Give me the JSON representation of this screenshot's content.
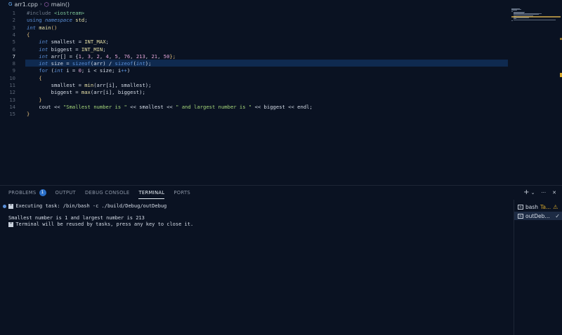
{
  "breadcrumb": {
    "file": "arr1.cpp",
    "symbol": "main()",
    "file_icon": "cpp-file-icon",
    "symbol_icon": "cube-icon"
  },
  "editor": {
    "current_line": 7,
    "line_numbers": [
      "1",
      "2",
      "3",
      "4",
      "5",
      "6",
      "7",
      "8",
      "9",
      "10",
      "11",
      "12",
      "13",
      "14",
      "15"
    ],
    "lines": [
      [
        {
          "t": "#include ",
          "c": "pp"
        },
        {
          "t": "<iostream>",
          "c": "inc"
        }
      ],
      [
        {
          "t": "using ",
          "c": "kw"
        },
        {
          "t": "namespace ",
          "c": "kwi"
        },
        {
          "t": "std",
          "c": "fn"
        },
        {
          "t": ";",
          "c": "op"
        }
      ],
      [
        {
          "t": "int ",
          "c": "kwi"
        },
        {
          "t": "main",
          "c": "fn"
        },
        {
          "t": "()",
          "c": "brk"
        }
      ],
      [
        {
          "t": "{",
          "c": "brk"
        }
      ],
      [
        {
          "t": "    int ",
          "c": "kwi"
        },
        {
          "t": "smallest = ",
          "c": "id"
        },
        {
          "t": "INT_MAX",
          "c": "fn"
        },
        {
          "t": ";",
          "c": "op"
        }
      ],
      [
        {
          "t": "    int ",
          "c": "kwi"
        },
        {
          "t": "biggest = ",
          "c": "id"
        },
        {
          "t": "INT_MIN",
          "c": "fn"
        },
        {
          "t": ";",
          "c": "op"
        }
      ],
      [
        {
          "t": "    int ",
          "c": "kwi"
        },
        {
          "t": "arr[] = {",
          "c": "id"
        },
        {
          "t": "1",
          "c": "num"
        },
        {
          "t": ", ",
          "c": "op"
        },
        {
          "t": "3",
          "c": "num"
        },
        {
          "t": ", ",
          "c": "op"
        },
        {
          "t": "2",
          "c": "num"
        },
        {
          "t": ", ",
          "c": "op"
        },
        {
          "t": "4",
          "c": "num"
        },
        {
          "t": ", ",
          "c": "op"
        },
        {
          "t": "5",
          "c": "num"
        },
        {
          "t": ", ",
          "c": "op"
        },
        {
          "t": "76",
          "c": "num"
        },
        {
          "t": ", ",
          "c": "op"
        },
        {
          "t": "213",
          "c": "num"
        },
        {
          "t": ", ",
          "c": "op"
        },
        {
          "t": "21",
          "c": "num"
        },
        {
          "t": ", ",
          "c": "op"
        },
        {
          "t": "50",
          "c": "num"
        },
        {
          "t": "};",
          "c": "brk"
        }
      ],
      [
        {
          "t": "    int ",
          "c": "kwi"
        },
        {
          "t": "size = ",
          "c": "id"
        },
        {
          "t": "sizeof",
          "c": "kw"
        },
        {
          "t": "(arr) / ",
          "c": "id"
        },
        {
          "t": "sizeof",
          "c": "kw"
        },
        {
          "t": "(",
          "c": "id"
        },
        {
          "t": "int",
          "c": "kwi"
        },
        {
          "t": ");",
          "c": "id"
        }
      ],
      [
        {
          "t": "    for ",
          "c": "kw"
        },
        {
          "t": "(",
          "c": "id"
        },
        {
          "t": "int ",
          "c": "kwi"
        },
        {
          "t": "i = ",
          "c": "id"
        },
        {
          "t": "0",
          "c": "num"
        },
        {
          "t": "; i < size; i",
          "c": "id"
        },
        {
          "t": "++",
          "c": "kw"
        },
        {
          "t": ")",
          "c": "id"
        }
      ],
      [
        {
          "t": "    {",
          "c": "brk"
        }
      ],
      [
        {
          "t": "        smallest = ",
          "c": "id"
        },
        {
          "t": "min",
          "c": "fn"
        },
        {
          "t": "(arr[i], smallest);",
          "c": "id"
        }
      ],
      [
        {
          "t": "        biggest = ",
          "c": "id"
        },
        {
          "t": "max",
          "c": "fn"
        },
        {
          "t": "(arr[i], biggest);",
          "c": "id"
        }
      ],
      [
        {
          "t": "    }",
          "c": "brk"
        }
      ],
      [
        {
          "t": "    cout << ",
          "c": "id"
        },
        {
          "t": "\"Smallest number is \"",
          "c": "str"
        },
        {
          "t": " << smallest << ",
          "c": "id"
        },
        {
          "t": "\" and largest number is \"",
          "c": "str"
        },
        {
          "t": " << biggest << endl;",
          "c": "id"
        }
      ],
      [
        {
          "t": "}",
          "c": "brk"
        }
      ]
    ]
  },
  "panel": {
    "tabs": [
      {
        "label": "PROBLEMS",
        "badge": "1",
        "active": false
      },
      {
        "label": "OUTPUT",
        "active": false
      },
      {
        "label": "DEBUG CONSOLE",
        "active": false
      },
      {
        "label": "TERMINAL",
        "active": true
      },
      {
        "label": "PORTS",
        "active": false
      }
    ],
    "actions": {
      "add_label": "+",
      "chevron": "⌄",
      "more": "···",
      "close": "✕"
    }
  },
  "terminal": {
    "task_badge": "*",
    "executing": "Executing task: /bin/bash -c ./build/Debug/outDebug",
    "output": "Smallest number is 1 and largest number is 213",
    "reuse_badge": "*",
    "reuse_msg": "Terminal will be reused by tasks, press any key to close it."
  },
  "terminal_list": [
    {
      "name": "bash",
      "suffix": "Ta...",
      "status": "warning",
      "selected": false
    },
    {
      "name": "outDeb...",
      "status": "check",
      "selected": true
    }
  ],
  "colors": {
    "background": "#0a1222",
    "current_line": "#0f2a50",
    "accent": "#2b70c9",
    "warning": "#d4a72c"
  }
}
